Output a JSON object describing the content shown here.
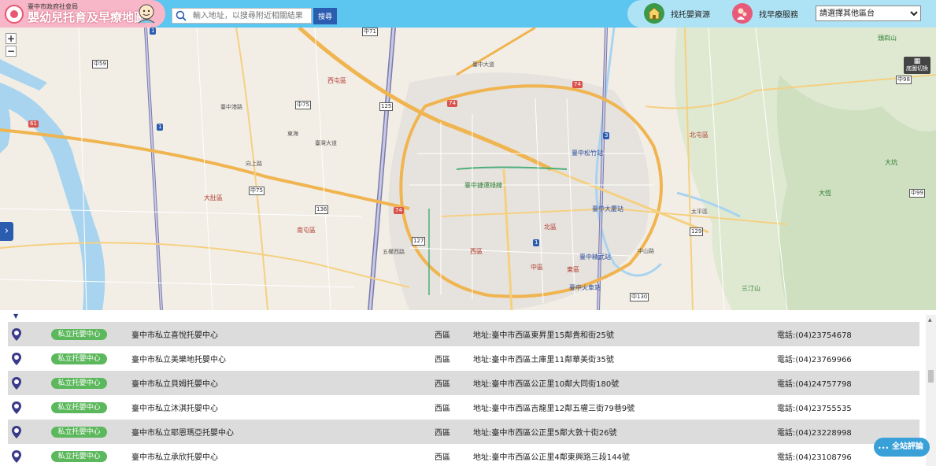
{
  "header": {
    "agency": "臺中市政府社會局",
    "title": "嬰幼兒托育及早療地圖",
    "search_placeholder": "輸入地址，以搜尋附近相關結果",
    "search_button": "搜尋",
    "service_childcare": "找托嬰資源",
    "service_early": "找早療服務",
    "area_select": "請選擇其他區台"
  },
  "map": {
    "zoom_in": "+",
    "zoom_out": "−",
    "layer_button": "底圖切換",
    "side_toggle": "›",
    "arrow_up": "^",
    "arrow_down": "v",
    "labels": {
      "l1": "南屯區",
      "l2": "西屯區",
      "l3": "大肚區",
      "l4": "南區",
      "l5": "西區",
      "l6": "北區",
      "l7": "中區",
      "l8": "東區",
      "l9": "北屯區",
      "l10": "太平區",
      "l11": "臺中港路",
      "l12": "臺灣大道",
      "l13": "臺中捷運綠線",
      "l14": "臺中火車站",
      "l15": "臺中松竹站",
      "l16": "臺中大慶站",
      "l17": "大坑",
      "l18": "頭嵙山",
      "l19": "三汀山",
      "l20": "臺中精武站",
      "l21": "五權西路",
      "l22": "向上路",
      "l23": "中山路",
      "l24": "臺中大道",
      "l25": "東海",
      "l26": "大恆"
    }
  },
  "results": [
    {
      "type": "私立托嬰中心",
      "name": "臺中市私立喜悅托嬰中心",
      "district": "西區",
      "address": "地址:臺中市西區東昇里15鄰貴和街25號",
      "phone": "電話:(04)23754678"
    },
    {
      "type": "私立托嬰中心",
      "name": "臺中市私立美樂地托嬰中心",
      "district": "西區",
      "address": "地址:臺中市西區土庫里11鄰華美街35號",
      "phone": "電話:(04)23769966"
    },
    {
      "type": "私立托嬰中心",
      "name": "臺中市私立貝姆托嬰中心",
      "district": "西區",
      "address": "地址:臺中市西區公正里10鄰大同街180號",
      "phone": "電話:(04)24757798"
    },
    {
      "type": "私立托嬰中心",
      "name": "臺中市私立沐淇托嬰中心",
      "district": "西區",
      "address": "地址:臺中市西區吉龍里12鄰五權三街79巷9號",
      "phone": "電話:(04)23755535"
    },
    {
      "type": "私立托嬰中心",
      "name": "臺中市私立耶恩瑪亞托嬰中心",
      "district": "西區",
      "address": "地址:臺中市西區公正里5鄰大敦十街26號",
      "phone": "電話:(04)23228998"
    },
    {
      "type": "私立托嬰中心",
      "name": "臺中市私立承欣托嬰中心",
      "district": "西區",
      "address": "地址:臺中市西區公正里4鄰東興路三段144號",
      "phone": "電話:(04)23108796"
    }
  ],
  "feedback_button": "全站評論",
  "colors": {
    "header": "#5cc6f0",
    "logo_bg": "#f8b6c9",
    "accent_blue": "#2a5cb0",
    "badge_green": "#5cb85c",
    "row_shade": "#dcdcdc"
  }
}
